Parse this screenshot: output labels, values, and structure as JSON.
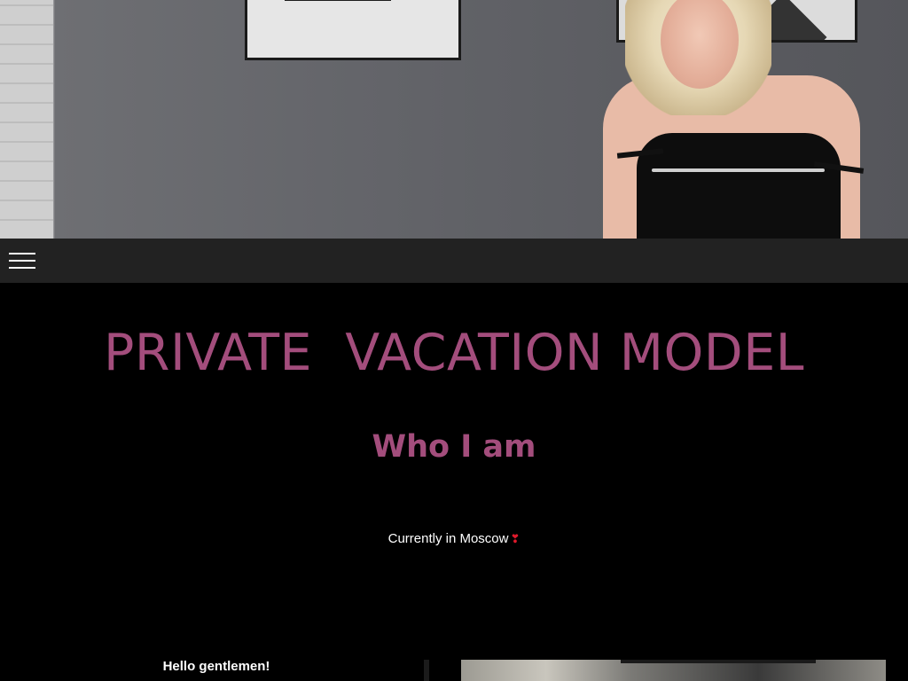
{
  "navbar": {
    "menu_icon": "hamburger-menu-icon"
  },
  "header": {
    "site_title": "PRIVATE  VACATION MODEL"
  },
  "about": {
    "heading": "Who I am",
    "location_text": "Currently in Moscow",
    "location_icon": "❣",
    "greeting": "Hello gentlemen!"
  },
  "colors": {
    "accent": "#a34d7c",
    "navbar_bg": "#222222",
    "page_bg": "#000000",
    "heart": "#e0192b"
  }
}
